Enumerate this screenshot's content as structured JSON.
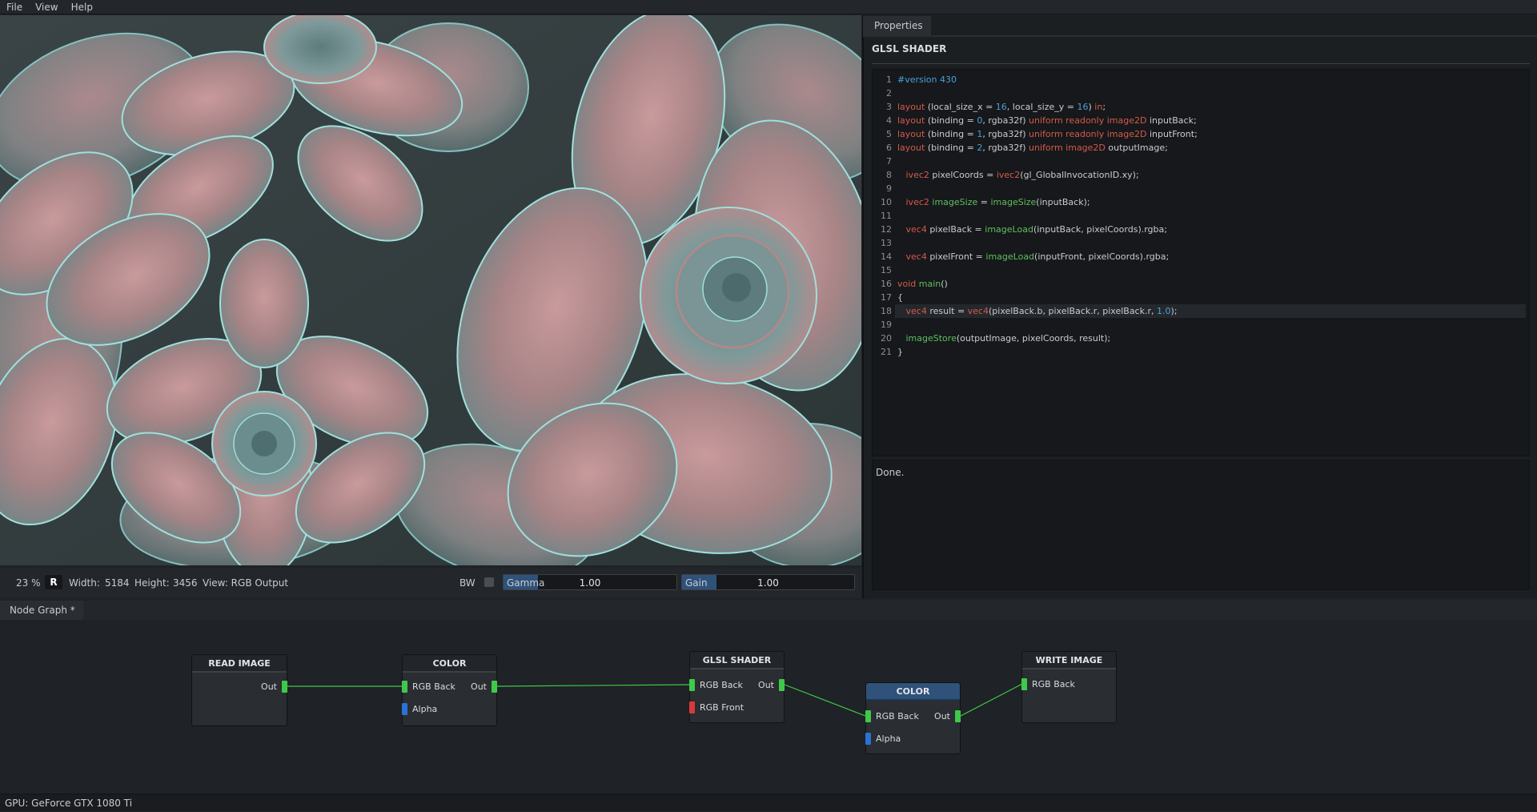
{
  "menu": {
    "items": [
      "File",
      "View",
      "Help"
    ]
  },
  "viewer": {
    "zoom": "23 %",
    "r_button": "R",
    "width_label": "Width:",
    "width_value": "5184",
    "height_label": "Height:",
    "height_value": "3456",
    "view_label": "View: RGB Output",
    "bw_label": "BW",
    "bw_checked": false,
    "gamma": {
      "name": "Gamma",
      "value": "1.00",
      "fill": 0.2
    },
    "gain": {
      "name": "Gain",
      "value": "1.00",
      "fill": 0.2
    }
  },
  "properties": {
    "tab_label": "Properties",
    "title": "GLSL SHADER",
    "console_text": "Done.",
    "highlight_line": 18,
    "code": [
      [
        [
          "kw-blue",
          "#version 430"
        ]
      ],
      [],
      [
        [
          "kw-red",
          "layout"
        ],
        [
          "",
          " (local_size_x = "
        ],
        [
          "kw-blue",
          "16"
        ],
        [
          "",
          ", local_size_y = "
        ],
        [
          "kw-blue",
          "16"
        ],
        [
          "",
          ") "
        ],
        [
          "kw-red",
          "in"
        ],
        [
          "",
          ";"
        ]
      ],
      [
        [
          "kw-red",
          "layout"
        ],
        [
          "",
          " (binding = "
        ],
        [
          "kw-blue",
          "0"
        ],
        [
          "",
          ", rgba32f) "
        ],
        [
          "kw-red",
          "uniform readonly image2D"
        ],
        [
          "",
          " inputBack;"
        ]
      ],
      [
        [
          "kw-red",
          "layout"
        ],
        [
          "",
          " (binding = "
        ],
        [
          "kw-blue",
          "1"
        ],
        [
          "",
          ", rgba32f) "
        ],
        [
          "kw-red",
          "uniform readonly image2D"
        ],
        [
          "",
          " inputFront;"
        ]
      ],
      [
        [
          "kw-red",
          "layout"
        ],
        [
          "",
          " (binding = "
        ],
        [
          "kw-blue",
          "2"
        ],
        [
          "",
          ", rgba32f) "
        ],
        [
          "kw-red",
          "uniform image2D"
        ],
        [
          "",
          " outputImage;"
        ]
      ],
      [],
      [
        [
          "",
          "   "
        ],
        [
          "kw-red",
          "ivec2"
        ],
        [
          "",
          " pixelCoords = "
        ],
        [
          "kw-red",
          "ivec2"
        ],
        [
          "",
          "(gl_GlobalInvocationID.xy);"
        ]
      ],
      [],
      [
        [
          "",
          "   "
        ],
        [
          "kw-red",
          "ivec2"
        ],
        [
          "",
          " "
        ],
        [
          "kw-green",
          "imageSize"
        ],
        [
          "",
          " = "
        ],
        [
          "kw-green",
          "imageSize"
        ],
        [
          "",
          "(inputBack);"
        ]
      ],
      [],
      [
        [
          "",
          "   "
        ],
        [
          "kw-red",
          "vec4"
        ],
        [
          "",
          " pixelBack = "
        ],
        [
          "kw-green",
          "imageLoad"
        ],
        [
          "",
          "(inputBack, pixelCoords).rgba;"
        ]
      ],
      [],
      [
        [
          "",
          "   "
        ],
        [
          "kw-red",
          "vec4"
        ],
        [
          "",
          " pixelFront = "
        ],
        [
          "kw-green",
          "imageLoad"
        ],
        [
          "",
          "(inputFront, pixelCoords).rgba;"
        ]
      ],
      [],
      [
        [
          "kw-red",
          "void"
        ],
        [
          "",
          " "
        ],
        [
          "kw-green",
          "main"
        ],
        [
          "",
          "()"
        ]
      ],
      [
        [
          "",
          "{"
        ]
      ],
      [
        [
          "",
          "   "
        ],
        [
          "kw-red",
          "vec4"
        ],
        [
          "",
          " result = "
        ],
        [
          "kw-red",
          "vec4"
        ],
        [
          "",
          "(pixelBack.b, pixelBack.r, pixelBack.r, "
        ],
        [
          "kw-blue",
          "1.0"
        ],
        [
          "",
          ");"
        ]
      ],
      [],
      [
        [
          "",
          "   "
        ],
        [
          "kw-green",
          "imageStore"
        ],
        [
          "",
          "(outputImage, pixelCoords, result);"
        ]
      ],
      [
        [
          "",
          "}"
        ]
      ]
    ]
  },
  "node_graph": {
    "tab_label": "Node Graph *",
    "nodes": {
      "read_image": {
        "title": "READ IMAGE",
        "out": "Out"
      },
      "color1": {
        "title": "COLOR",
        "in1": "RGB Back",
        "in2": "Alpha",
        "out": "Out"
      },
      "glsl": {
        "title": "GLSL SHADER",
        "in1": "RGB Back",
        "in2": "RGB Front",
        "out": "Out"
      },
      "color2": {
        "title": "COLOR",
        "in1": "RGB Back",
        "in2": "Alpha",
        "out": "Out"
      },
      "write_image": {
        "title": "WRITE IMAGE",
        "in1": "RGB Back"
      }
    }
  },
  "status": {
    "gpu": "GPU: GeForce GTX 1080 Ti"
  },
  "colors": {
    "accent": "#2f527a",
    "port_green": "#3ec94a",
    "port_blue": "#2a72d6",
    "port_red": "#d83a3a",
    "link": "#3ec94a"
  }
}
